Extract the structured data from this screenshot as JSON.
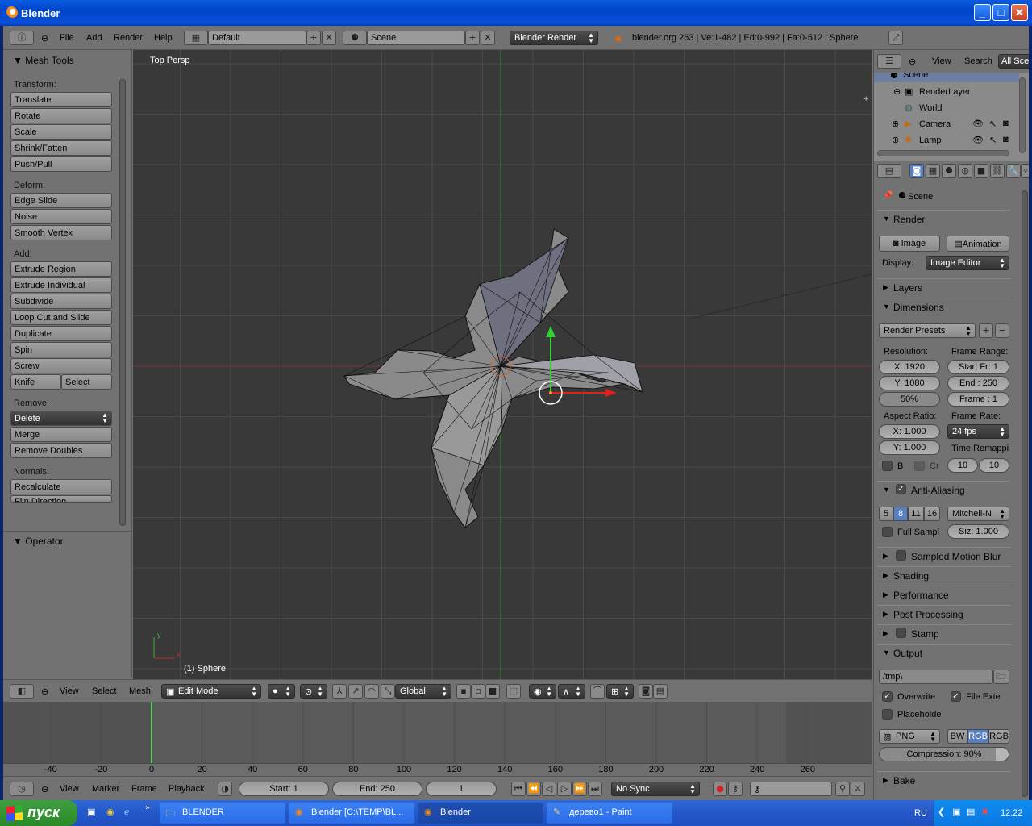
{
  "window": {
    "title": "Blender"
  },
  "topbar": {
    "menus": [
      "File",
      "Add",
      "Render",
      "Help"
    ],
    "screen_layout": "Default",
    "scene": "Scene",
    "engine": "Blender Render",
    "stats": "blender.org 263 | Ve:1-482 | Ed:0-992 | Fa:0-512 | Sphere"
  },
  "toolshelf": {
    "title": "Mesh Tools",
    "transform_label": "Transform:",
    "transform": [
      "Translate",
      "Rotate",
      "Scale",
      "Shrink/Fatten",
      "Push/Pull"
    ],
    "deform_label": "Deform:",
    "deform": [
      "Edge Slide",
      "Noise",
      "Smooth Vertex"
    ],
    "add_label": "Add:",
    "add": [
      "Extrude Region",
      "Extrude Individual",
      "Subdivide",
      "Loop Cut and Slide",
      "Duplicate",
      "Spin",
      "Screw"
    ],
    "knife": "Knife",
    "select": "Select",
    "remove_label": "Remove:",
    "delete": "Delete",
    "remove": [
      "Merge",
      "Remove Doubles"
    ],
    "normals_label": "Normals:",
    "normals": [
      "Recalculate",
      "Flip Direction"
    ],
    "operator": "Operator"
  },
  "viewport": {
    "view_label": "Top Persp",
    "object_label": "(1) Sphere",
    "axis_x": "x",
    "axis_y": "y",
    "colors": {
      "background": "#393939",
      "grid": "#4a4a4a",
      "x_axis": "#8a2f2f",
      "y_axis": "#2f8a2f"
    }
  },
  "header3d": {
    "menus": [
      "View",
      "Select",
      "Mesh"
    ],
    "mode": "Edit Mode",
    "orientation": "Global"
  },
  "timeline": {
    "ruler": [
      "-40",
      "-20",
      "0",
      "20",
      "40",
      "60",
      "80",
      "100",
      "120",
      "140",
      "160",
      "180",
      "200",
      "220",
      "240",
      "260"
    ],
    "menus": [
      "View",
      "Marker",
      "Frame",
      "Playback"
    ],
    "start": "Start: 1",
    "end": "End: 250",
    "current": "1",
    "sync": "No Sync"
  },
  "outliner": {
    "menus": [
      "View",
      "Search"
    ],
    "filter": "All Sce",
    "items": [
      "Scene",
      "RenderLayer",
      "World",
      "Camera",
      "Lamp"
    ]
  },
  "properties": {
    "context": "Scene",
    "render_panel": "Render",
    "image_btn": "Image",
    "animation_btn": "Animation",
    "display_label": "Display:",
    "display_value": "Image Editor",
    "layers_panel": "Layers",
    "dimensions_panel": "Dimensions",
    "render_presets": "Render Presets",
    "resolution_label": "Resolution:",
    "res_x": "X: 1920",
    "res_y": "Y: 1080",
    "res_pct": "50%",
    "frame_range_label": "Frame Range:",
    "start_fr": "Start Fr: 1",
    "end_fr": "End : 250",
    "frame": "Frame : 1",
    "aspect_label": "Aspect Ratio:",
    "aspect_x": "X: 1.000",
    "aspect_y": "Y: 1.000",
    "frame_rate_label": "Frame Rate:",
    "fps": "24 fps",
    "time_remap_label": "Time Remappi",
    "remap_old": "10",
    "remap_new": "10",
    "border_b": "B",
    "border_cr": "Cr",
    "aa_panel": "Anti-Aliasing",
    "aa_samples": [
      "5",
      "8",
      "11",
      "16"
    ],
    "aa_filter": "Mitchell-N",
    "full_sample": "Full Sampl",
    "filter_size": "Siz: 1.000",
    "motion_blur_panel": "Sampled Motion Blur",
    "shading_panel": "Shading",
    "performance_panel": "Performance",
    "post_panel": "Post Processing",
    "stamp_panel": "Stamp",
    "output_panel": "Output",
    "output_path": "/tmp\\",
    "overwrite": "Overwrite",
    "file_ext": "File Exte",
    "placeholder": "Placeholde",
    "format": "PNG",
    "color_modes": [
      "BW",
      "RGB",
      "RGB"
    ],
    "compression": "Compression: 90%",
    "bake_panel": "Bake"
  },
  "taskbar": {
    "start": "пуск",
    "tasks": [
      "BLENDER",
      "Blender [C:\\TEMP\\BL...",
      "Blender",
      "дерево1 - Paint"
    ],
    "lang": "RU",
    "clock": "12:22"
  }
}
